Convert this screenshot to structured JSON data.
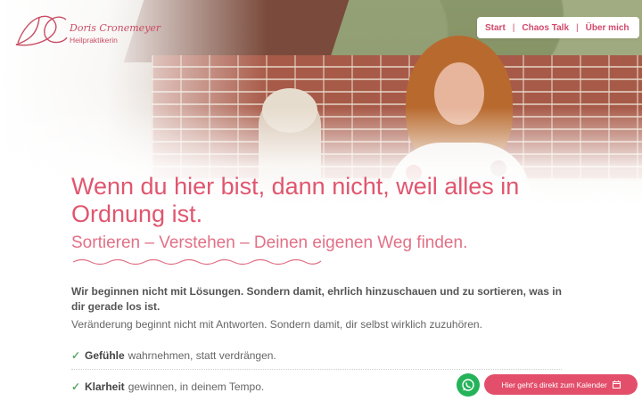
{
  "brand": {
    "monogram": "DC",
    "name": "Doris Cronemeyer",
    "subtitle": "Heilpraktikerin"
  },
  "nav": {
    "items": [
      "Start",
      "Chaos Talk",
      "Über mich"
    ],
    "separator": "|"
  },
  "hero": {
    "headline": "Wenn du hier bist, dann nicht, weil alles in Ordnung ist.",
    "subheadline": "Sortieren – Verstehen – Deinen eigenen Weg finden."
  },
  "content": {
    "intro_bold": "Wir beginnen nicht mit Lösungen. Sondern damit, ehrlich hinzuschauen und zu sortieren, was in dir gerade los ist.",
    "intro_text": "Veränderung beginnt nicht mit Antworten. Sondern damit, dir selbst wirklich zuzuhören.",
    "checklist": [
      {
        "bold": "Gefühle",
        "text": "wahrnehmen, statt verdrängen."
      },
      {
        "bold": "Klarheit",
        "text": "gewinnen, in deinem Tempo."
      }
    ]
  },
  "floating": {
    "whatsapp_icon": "whatsapp-icon",
    "calendar_label": "Hier geht's direkt zum Kalender",
    "calendar_icon": "calendar-icon"
  },
  "colors": {
    "accent": "#e0566f",
    "nav": "#d2486a",
    "check": "#5fa86b",
    "whatsapp": "#25b35a",
    "calendar_button": "#e34f6b"
  }
}
